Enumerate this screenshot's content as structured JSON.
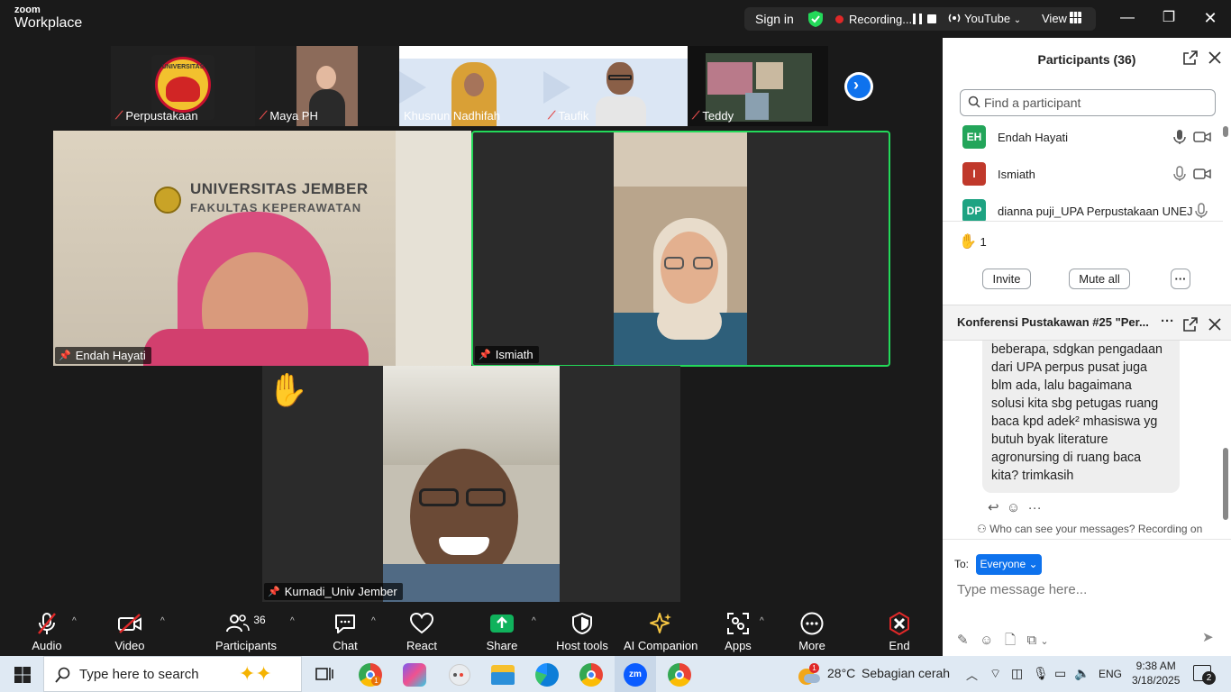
{
  "window": {
    "logo_top": "zoom",
    "logo_bottom": "Workplace",
    "sign_in": "Sign in",
    "recording_label": "Recording...",
    "youtube_label": "YouTube",
    "view_label": "View",
    "minimize": "—",
    "maximize": "❐",
    "close": "✕"
  },
  "filmstrip": [
    {
      "name": "Perpustakaan",
      "muted": true
    },
    {
      "name": "Maya PH",
      "muted": true
    },
    {
      "name": "Khusnun Nadhifah",
      "muted": false
    },
    {
      "name": "Taufik",
      "muted": true
    },
    {
      "name": "Teddy",
      "muted": true
    }
  ],
  "filmstrip_next": "›",
  "tiles": {
    "left": {
      "name": "Endah Hayati"
    },
    "right": {
      "name": "Ismiath",
      "active_speaker": true
    },
    "bottom": {
      "name": "Kurnadi_Univ Jember",
      "raised_hand": true
    }
  },
  "scene_text": {
    "univ": "UNIVERSITAS JEMBER",
    "faculty": "FAKULTAS KEPERAWATAN",
    "thumb1_logo": "UNIVERSITAS"
  },
  "toolbar": {
    "audio": "Audio",
    "video": "Video",
    "participants": "Participants",
    "participants_count": "36",
    "chat": "Chat",
    "react": "React",
    "share": "Share",
    "host_tools": "Host tools",
    "ai_companion": "AI Companion",
    "apps": "Apps",
    "more": "More",
    "end": "End"
  },
  "participants_panel": {
    "title": "Participants (36)",
    "search_placeholder": "Find a participant",
    "list": [
      {
        "initials": "EH",
        "name": "Endah Hayati",
        "color": "#23a55a"
      },
      {
        "initials": "I",
        "name": "Ismiath",
        "color": "#c0392b"
      },
      {
        "initials": "DP",
        "name": "dianna puji_UPA Perpustakaan UNEJ",
        "color": "#1ea382"
      }
    ],
    "raised_hands": "1",
    "invite": "Invite",
    "mute_all": "Mute all",
    "more": "···"
  },
  "chat_panel": {
    "title": "Konferensi Pustakawan #25 \"Per...",
    "message": "beberapa, sdgkan pengadaan\ndari UPA perpus pusat juga\nblm ada, lalu bagaimana\nsolusi kita sbg petugas ruang\nbaca kpd adek² mhasiswa yg\nbutuh byak literature\nagronursing di ruang baca\nkita? trimkasih",
    "who_can_see": "Who can see your messages? Recording on",
    "to_label": "To:",
    "recipient": "Everyone",
    "input_placeholder": "Type message here..."
  },
  "taskbar": {
    "search_placeholder": "Type here to search",
    "weather_temp": "28°C",
    "weather_desc": "Sebagian cerah",
    "language": "ENG",
    "time": "9:38 AM",
    "date": "3/18/2025",
    "notifications": "2",
    "weather_badge": "1",
    "chrome_badge": "1"
  },
  "colors": {
    "zoom_blue": "#0e72ed",
    "active_green": "#23d959",
    "share_green": "#10b25c",
    "end_red": "#e02828"
  }
}
